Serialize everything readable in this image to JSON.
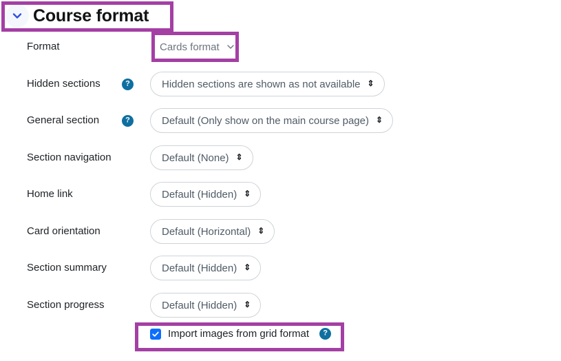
{
  "section": {
    "title": "Course format",
    "collapse_icon": "chevron-down-icon",
    "expanded": true
  },
  "colors": {
    "highlight_border": "#a43fa4",
    "help_icon_bg": "#0f6fa0",
    "checkbox_checked": "#0d6efd",
    "chevron": "#3250e0",
    "select_border": "#cfd3d7",
    "select_text": "#4f5b66",
    "label_text": "#1d2125"
  },
  "fields": [
    {
      "label": "Format",
      "has_help": false,
      "control": "plain-select",
      "value": "Cards format",
      "highlighted": true
    },
    {
      "label": "Hidden sections",
      "has_help": true,
      "help_label": "Help with Hidden sections",
      "control": "select",
      "value": "Hidden sections are shown as not available",
      "highlighted": false
    },
    {
      "label": "General section",
      "has_help": true,
      "help_label": "Help with General section",
      "control": "select",
      "value": "Default (Only show on the main course page)",
      "highlighted": false
    },
    {
      "label": "Section navigation",
      "has_help": false,
      "control": "select",
      "value": "Default (None)",
      "highlighted": false
    },
    {
      "label": "Home link",
      "has_help": false,
      "control": "select",
      "value": "Default (Hidden)",
      "highlighted": false
    },
    {
      "label": "Card orientation",
      "has_help": false,
      "control": "select",
      "value": "Default (Horizontal)",
      "highlighted": false
    },
    {
      "label": "Section summary",
      "has_help": false,
      "control": "select",
      "value": "Default (Hidden)",
      "highlighted": false
    },
    {
      "label": "Section progress",
      "has_help": false,
      "control": "select",
      "value": "Default (Hidden)",
      "highlighted": false
    }
  ],
  "import_images": {
    "label": "Import images from grid format",
    "checked": true,
    "check_glyph": "checkmark-icon",
    "help_label": "Help with Import images from grid format",
    "highlighted": true
  },
  "help_glyph": "?"
}
